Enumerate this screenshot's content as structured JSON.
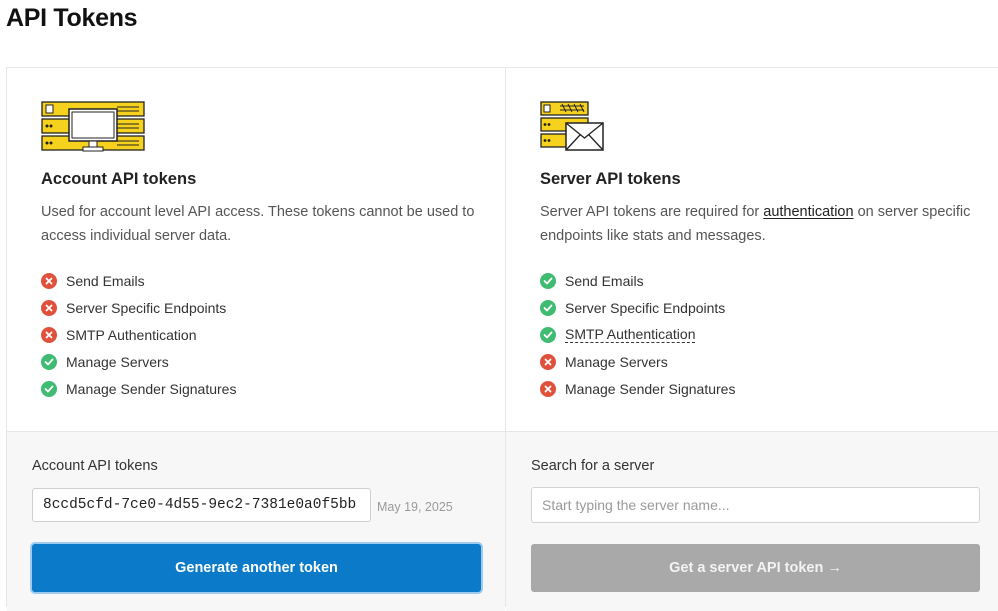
{
  "page": {
    "title": "API Tokens"
  },
  "account": {
    "title": "Account API tokens",
    "description": "Used for account level API access. These tokens cannot be used to access individual server data.",
    "features": [
      {
        "label": "Send Emails",
        "allowed": false
      },
      {
        "label": "Server Specific Endpoints",
        "allowed": false
      },
      {
        "label": "SMTP Authentication",
        "allowed": false
      },
      {
        "label": "Manage Servers",
        "allowed": true
      },
      {
        "label": "Manage Sender Signatures",
        "allowed": true
      }
    ],
    "field_label": "Account API tokens",
    "token_value": "8ccd5cfd-7ce0-4d55-9ec2-7381e0a0f5bb",
    "token_date": "May 19, 2025",
    "button_label": "Generate another token"
  },
  "server": {
    "title": "Server API tokens",
    "description_before": "Server API tokens are required for ",
    "description_link": "authentication",
    "description_after": " on server specific endpoints like stats and messages.",
    "features": [
      {
        "label": "Send Emails",
        "allowed": true
      },
      {
        "label": "Server Specific Endpoints",
        "allowed": true
      },
      {
        "label": "SMTP Authentication",
        "allowed": true
      },
      {
        "label": "Manage Servers",
        "allowed": false
      },
      {
        "label": "Manage Sender Signatures",
        "allowed": false
      }
    ],
    "field_label": "Search for a server",
    "search_placeholder": "Start typing the server name...",
    "button_label": "Get a server API token →"
  },
  "colors": {
    "accent": "#0b7bc9",
    "allowed": "#3fbb72",
    "denied": "#e0513c",
    "illustration": "#f6d21f"
  }
}
